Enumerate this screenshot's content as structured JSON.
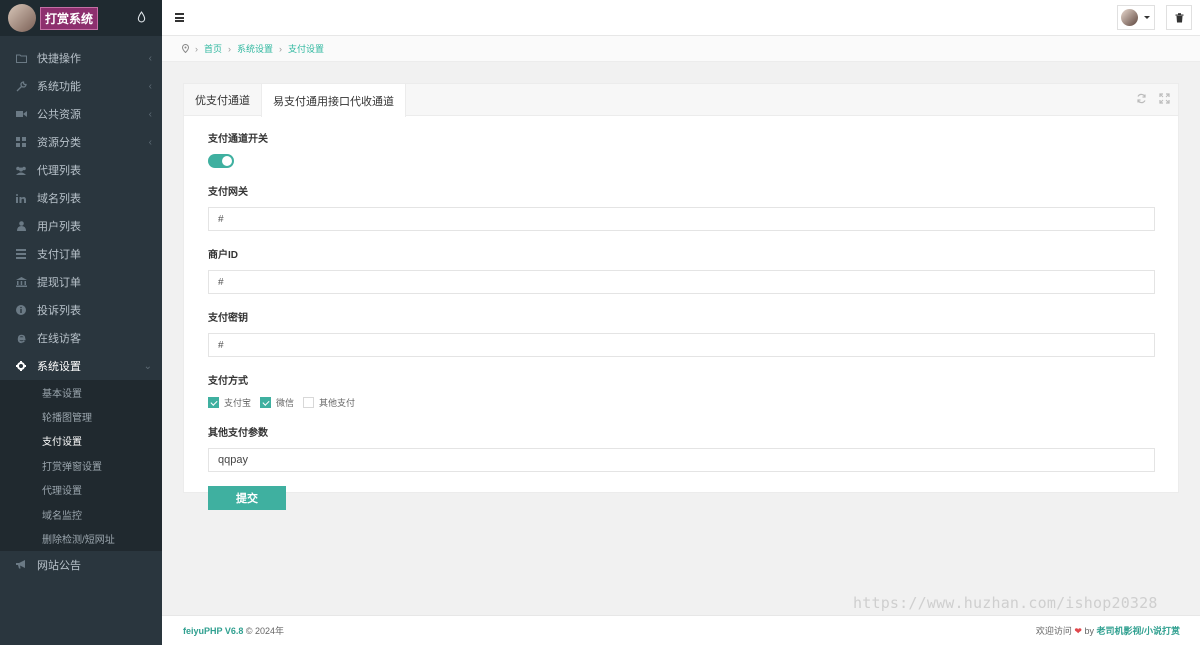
{
  "app": {
    "title": "打赏系统"
  },
  "sidebar": {
    "items": [
      {
        "label": "快捷操作",
        "icon": "folder-icon",
        "has_arrow": true
      },
      {
        "label": "系统功能",
        "icon": "wrench-icon",
        "has_arrow": true
      },
      {
        "label": "公共资源",
        "icon": "video-icon",
        "has_arrow": true
      },
      {
        "label": "资源分类",
        "icon": "grid-icon",
        "has_arrow": true
      },
      {
        "label": "代理列表",
        "icon": "users-icon",
        "has_arrow": false
      },
      {
        "label": "域名列表",
        "icon": "linkedin-icon",
        "has_arrow": false
      },
      {
        "label": "用户列表",
        "icon": "user-icon",
        "has_arrow": false
      },
      {
        "label": "支付订单",
        "icon": "list-icon",
        "has_arrow": false
      },
      {
        "label": "提现订单",
        "icon": "bank-icon",
        "has_arrow": false
      },
      {
        "label": "投诉列表",
        "icon": "info-icon",
        "has_arrow": false
      },
      {
        "label": "在线访客",
        "icon": "ie-icon",
        "has_arrow": false
      },
      {
        "label": "系统设置",
        "icon": "gear-icon",
        "has_arrow": true
      }
    ],
    "subitems": [
      "基本设置",
      "轮播图管理",
      "支付设置",
      "打赏弹窗设置",
      "代理设置",
      "域名监控",
      "删除检测/短网址"
    ],
    "active_subitem": 2,
    "last_item": {
      "label": "网站公告",
      "icon": "megaphone-icon"
    }
  },
  "breadcrumb": {
    "home": "首页",
    "section": "系统设置",
    "page": "支付设置"
  },
  "tabs": [
    {
      "label": "优支付通道"
    },
    {
      "label": "易支付通用接口代收通道"
    }
  ],
  "active_tab": 1,
  "form": {
    "switch_label": "支付通道开关",
    "gateway_label": "支付网关",
    "gateway_value": "#",
    "merchant_label": "商户ID",
    "merchant_value": "#",
    "key_label": "支付密钥",
    "key_value": "#",
    "methods_label": "支付方式",
    "methods": [
      {
        "label": "支付宝",
        "checked": true
      },
      {
        "label": "微信",
        "checked": true
      },
      {
        "label": "其他支付",
        "checked": false
      }
    ],
    "other_label": "其他支付参数",
    "other_value": "qqpay",
    "submit_label": "提交"
  },
  "footer": {
    "brand": "feiyuPHP V6.8",
    "copyright": "© 2024年",
    "welcome": "欢迎访问",
    "by": "by",
    "author": "老司机影视/小说打赏"
  },
  "watermark": "https://www.huzhan.com/ishop20328",
  "colors": {
    "accent": "#3fb0a0",
    "sidebar": "#2a363e"
  }
}
